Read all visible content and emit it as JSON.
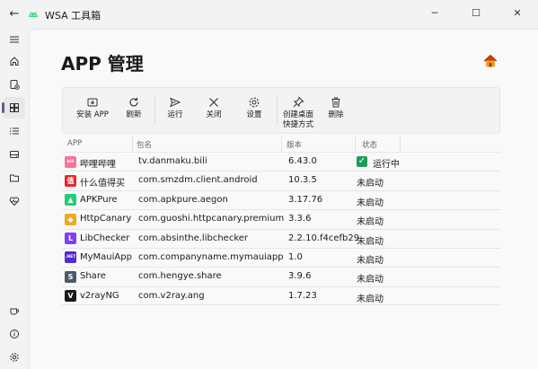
{
  "window": {
    "title": "WSA 工具箱",
    "back_glyph": "←",
    "min_glyph": "─",
    "max_glyph": "☐",
    "close_glyph": "✕"
  },
  "rail": {
    "items": [
      {
        "icon": "hamburger-icon"
      },
      {
        "icon": "home-icon"
      },
      {
        "icon": "install-icon"
      },
      {
        "icon": "apps-icon",
        "active": true
      },
      {
        "icon": "list-icon"
      },
      {
        "icon": "drive-icon"
      },
      {
        "icon": "folder-icon"
      },
      {
        "icon": "health-icon"
      }
    ],
    "bottom": [
      {
        "icon": "coffee-icon"
      },
      {
        "icon": "info-icon"
      },
      {
        "icon": "settings-icon"
      }
    ]
  },
  "page": {
    "title": "APP 管理"
  },
  "toolbar": {
    "install": "安装 APP",
    "refresh": "刷新",
    "run": "运行",
    "close": "关闭",
    "settings": "设置",
    "shortcut_line1": "创建桌面",
    "shortcut_line2": "快捷方式",
    "delete": "删除"
  },
  "table": {
    "headers": {
      "app": "APP",
      "package": "包名",
      "version": "版本",
      "state": "状态"
    },
    "rows": [
      {
        "app": "哔哩哔哩",
        "package": "tv.danmaku.bili",
        "version": "6.43.0",
        "state": "运行中",
        "running": true,
        "icon_color": "#fb7299",
        "icon_text": "bili"
      },
      {
        "app": "什么值得买",
        "package": "com.smzdm.client.android",
        "version": "10.3.5",
        "state": "未启动",
        "icon_color": "#e62828",
        "icon_text": "值"
      },
      {
        "app": "APKPure",
        "package": "com.apkpure.aegon",
        "version": "3.17.76",
        "state": "未启动",
        "icon_color": "#24cd77",
        "icon_text": "▲"
      },
      {
        "app": "HttpCanary",
        "package": "com.guoshi.httpcanary.premium",
        "version": "3.3.6",
        "state": "未启动",
        "icon_color": "#f5a623",
        "icon_text": "◆"
      },
      {
        "app": "LibChecker",
        "package": "com.absinthe.libchecker",
        "version": "2.2.10.f4cefb29",
        "state": "未启动",
        "icon_color": "#7e3ff2",
        "icon_text": "L"
      },
      {
        "app": "MyMauiApp",
        "package": "com.companyname.mymauiapp",
        "version": "1.0",
        "state": "未启动",
        "icon_color": "#512bd4",
        "icon_text": ".NET"
      },
      {
        "app": "Share",
        "package": "com.hengye.share",
        "version": "3.9.6",
        "state": "未启动",
        "icon_color": "#4a5a6a",
        "icon_text": "S"
      },
      {
        "app": "v2rayNG",
        "package": "com.v2ray.ang",
        "version": "1.7.23",
        "state": "未启动",
        "icon_color": "#1a1a1a",
        "icon_text": "V"
      }
    ]
  }
}
